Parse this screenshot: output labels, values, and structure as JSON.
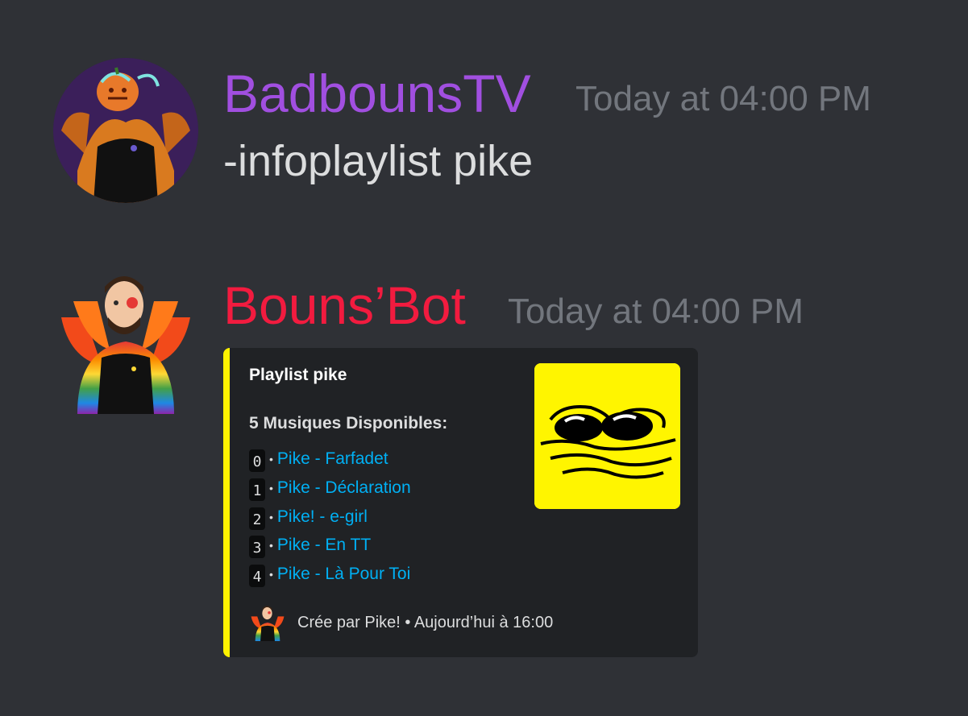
{
  "messages": [
    {
      "username": "BadbounsTV",
      "username_color": "#a14fe0",
      "timestamp": "Today at 04:00 PM",
      "content": "-infoplaylist pike",
      "avatar": "pumpkin-head-avatar"
    },
    {
      "username": "Bouns’Bot",
      "username_color": "#f21b3f",
      "timestamp": "Today at 04:00 PM",
      "avatar": "rainbow-hoodie-avatar",
      "embed": {
        "accent_color": "#fff200",
        "title": "Playlist pike",
        "subtitle": "5 Musiques Disponibles:",
        "tracks": [
          {
            "index": "0",
            "sep": "•",
            "label": "Pike - Farfadet"
          },
          {
            "index": "1",
            "sep": "•",
            "label": "Pike - Déclaration"
          },
          {
            "index": "2",
            "sep": "•",
            "label": "Pike! - e-girl"
          },
          {
            "index": "3",
            "sep": "•",
            "label": "Pike - En TT"
          },
          {
            "index": "4",
            "sep": "•",
            "label": "Pike - Là Pour Toi"
          }
        ],
        "thumbnail": "yellow-sunglasses-face-image",
        "footer": {
          "icon": "rainbow-hoodie-avatar",
          "text": "Crée par Pike! • Aujourd’hui à 16:00"
        }
      }
    }
  ],
  "colors": {
    "background": "#2f3136",
    "embed_background": "#202225",
    "link": "#00b0f4",
    "timestamp": "#72767d",
    "text": "#dcddde"
  }
}
